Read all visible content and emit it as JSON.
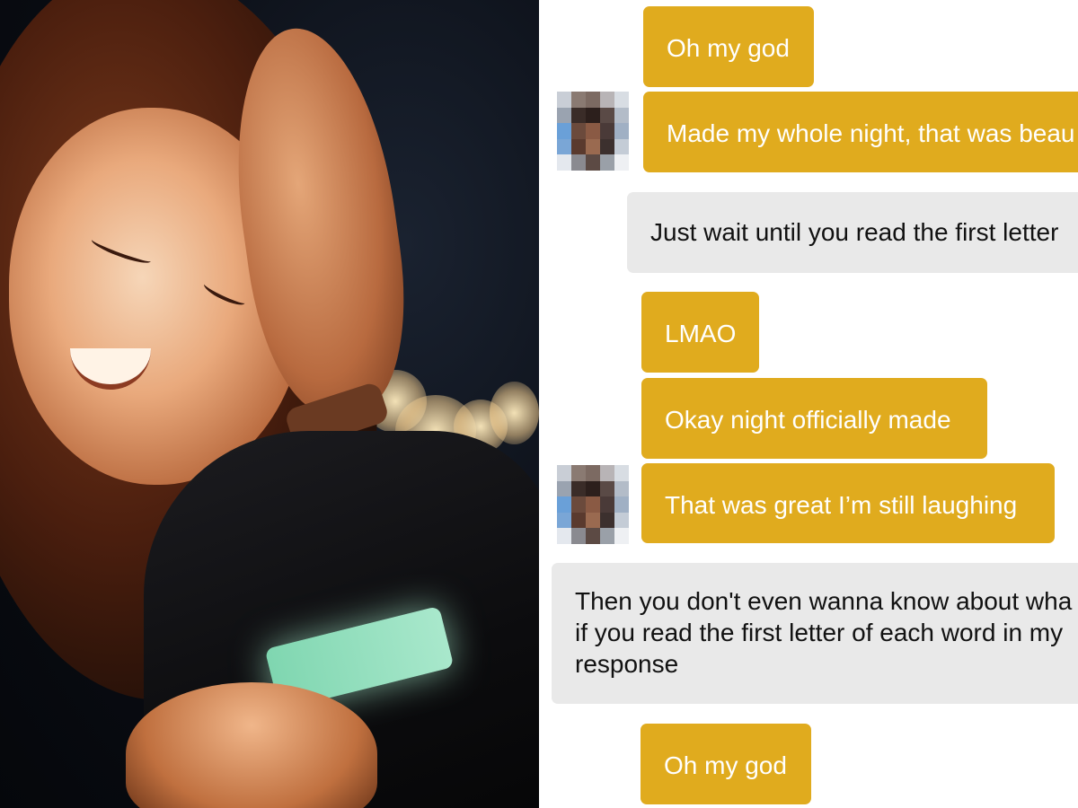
{
  "messages": [
    {
      "type": "sent",
      "text": "Oh my god"
    },
    {
      "type": "sent",
      "text": "Made my whole night, that was beau"
    },
    {
      "type": "received",
      "text": "Just wait until you read the first letter"
    },
    {
      "type": "sent",
      "text": "LMAO"
    },
    {
      "type": "sent",
      "text": "Okay night officially made"
    },
    {
      "type": "sent",
      "text": "That was great I’m still laughing"
    },
    {
      "type": "received",
      "lines": [
        "Then you don't even wanna know about wha",
        "if you read the first letter of each word in my",
        "response"
      ]
    },
    {
      "type": "sent",
      "text": "Oh my god"
    }
  ],
  "colors": {
    "sent_bubble": "#e0ab1e",
    "received_bubble": "#e9e9e9",
    "chat_background": "#ffffff"
  }
}
